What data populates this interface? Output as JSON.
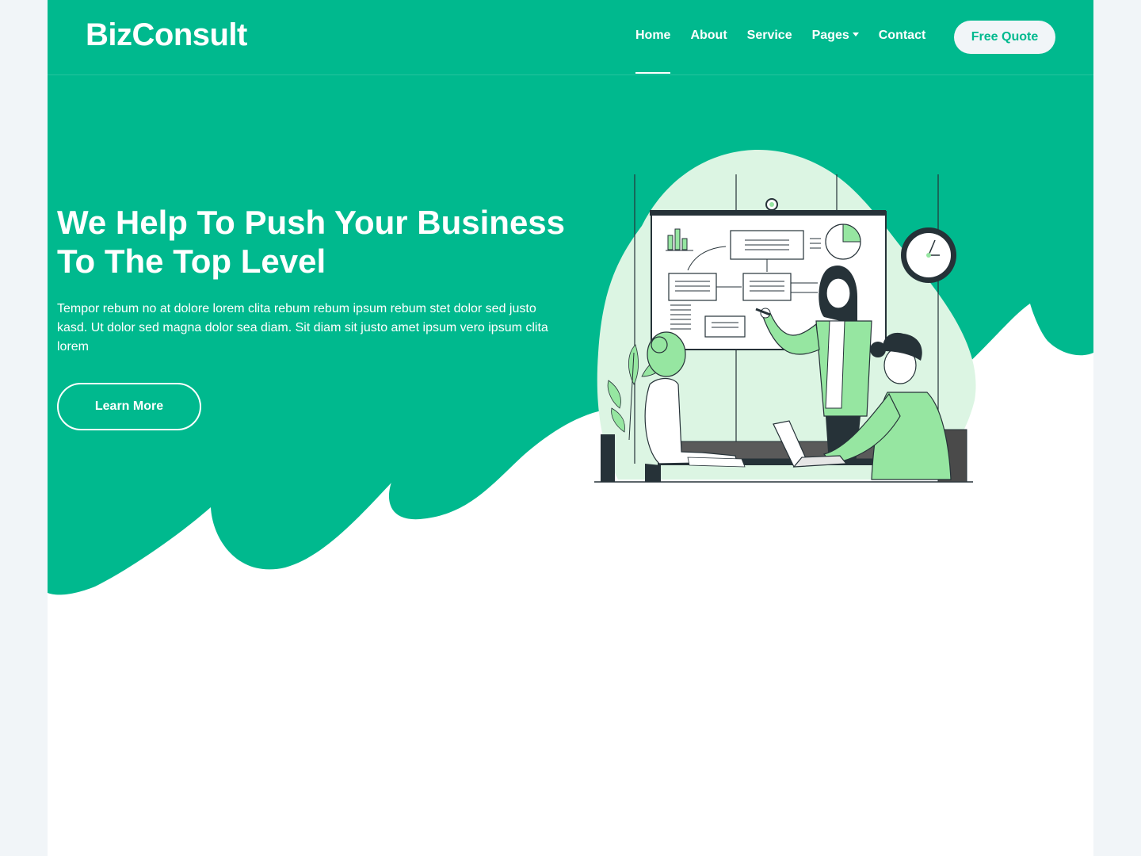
{
  "brand": "BizConsult",
  "nav": {
    "items": [
      "Home",
      "About",
      "Service",
      "Pages",
      "Contact"
    ],
    "active": "Home",
    "quote_label": "Free Quote"
  },
  "hero": {
    "title": "We Help To Push Your Business To The Top Level",
    "text": "Tempor rebum no at dolore lorem clita rebum rebum ipsum rebum stet dolor sed justo kasd. Ut dolor sed magna dolor sea diam. Sit diam sit justo amet ipsum vero ipsum clita lorem",
    "button_label": "Learn More"
  },
  "colors": {
    "primary": "#00b98e",
    "light": "#f1f5f8",
    "illustration_green": "#96e6a1",
    "illustration_bg": "#dcf5e3",
    "dark": "#263238"
  },
  "icons": {
    "back_to_top": "arrow-up-icon",
    "pages_dropdown": "caret-down-icon"
  }
}
